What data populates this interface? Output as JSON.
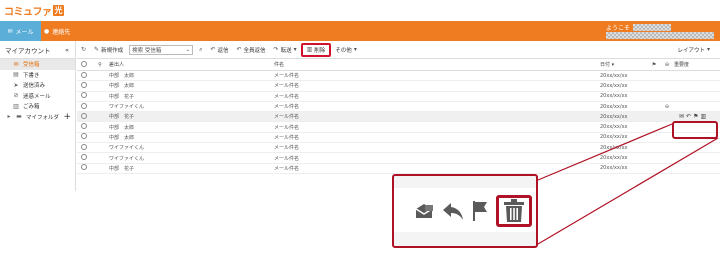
{
  "brand": {
    "name": "コミュファ",
    "mark": "光",
    "color": "#ee7a1e"
  },
  "nav": {
    "mail_label": "メール",
    "contacts_label": "連絡先",
    "welcome": "ようこそ"
  },
  "sidebar": {
    "title": "マイアカウント",
    "collapse_glyph": "«",
    "items": [
      {
        "label": "受信箱",
        "icon": "inbox-icon",
        "active": true
      },
      {
        "label": "下書き",
        "icon": "draft-icon",
        "active": false
      },
      {
        "label": "送信済み",
        "icon": "sent-icon",
        "active": false
      },
      {
        "label": "迷惑メール",
        "icon": "spam-icon",
        "active": false
      },
      {
        "label": "ごみ箱",
        "icon": "trash-icon",
        "active": false
      }
    ],
    "folder_label": "マイフォルダ",
    "add_glyph": "+"
  },
  "toolbar": {
    "new_label": "新規作成",
    "search_placeholder": "検索 受信箱",
    "reply_label": "返信",
    "reply_all_label": "全員返信",
    "forward_label": "転送",
    "delete_label": "削除",
    "other_label": "その他",
    "layout_label": "レイアウト"
  },
  "table": {
    "headers": {
      "from": "差出人",
      "subject": "件名",
      "date": "日付",
      "importance": "重要度"
    },
    "rows": [
      {
        "from": "中部　太郎",
        "subject": "メール件名",
        "date": "20xx/xx/xx",
        "highlight": false,
        "attachment": false
      },
      {
        "from": "中部　太郎",
        "subject": "メール件名",
        "date": "20xx/xx/xx",
        "highlight": false,
        "attachment": false
      },
      {
        "from": "中部　花子",
        "subject": "メール件名",
        "date": "20xx/xx/xx",
        "highlight": false,
        "attachment": false
      },
      {
        "from": "ワイファイくん",
        "subject": "メール件名",
        "date": "20xx/xx/xx",
        "highlight": false,
        "attachment": true
      },
      {
        "from": "中部　花子",
        "subject": "メール件名",
        "date": "20xx/xx/xx",
        "highlight": true,
        "attachment": false
      },
      {
        "from": "中部　太郎",
        "subject": "メール件名",
        "date": "20xx/xx/xx",
        "highlight": false,
        "attachment": false
      },
      {
        "from": "中部　太郎",
        "subject": "メール件名",
        "date": "20xx/xx/xx",
        "highlight": false,
        "attachment": false
      },
      {
        "from": "ワイファイくん",
        "subject": "メール件名",
        "date": "20xx/xx/xx",
        "highlight": false,
        "attachment": false
      },
      {
        "from": "ワイファイくん",
        "subject": "メール件名",
        "date": "20xx/xx/xx",
        "highlight": false,
        "attachment": false
      },
      {
        "from": "中部　花子",
        "subject": "メール件名",
        "date": "20xx/xx/xx",
        "highlight": false,
        "attachment": false
      }
    ]
  },
  "colors": {
    "orange": "#f07c22",
    "mail_tab": "#5aaed8",
    "callout": "#b01225",
    "delete_outline": "#d0122b"
  }
}
